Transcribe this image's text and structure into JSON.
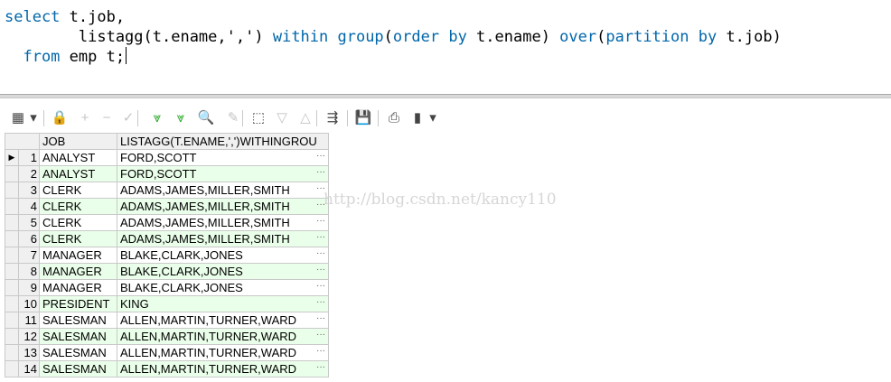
{
  "editor": {
    "lines": [
      [
        {
          "t": "select",
          "c": "kw"
        },
        {
          "t": " t.job,",
          "c": ""
        }
      ],
      [
        {
          "t": "        listagg(t.ename,",
          "c": ""
        },
        {
          "t": "','",
          "c": "str"
        },
        {
          "t": ") ",
          "c": ""
        },
        {
          "t": "within group",
          "c": "kw"
        },
        {
          "t": "(",
          "c": ""
        },
        {
          "t": "order by",
          "c": "kw"
        },
        {
          "t": " t.ename) ",
          "c": ""
        },
        {
          "t": "over",
          "c": "kw"
        },
        {
          "t": "(",
          "c": ""
        },
        {
          "t": "partition by",
          "c": "kw"
        },
        {
          "t": " t.job)",
          "c": ""
        }
      ],
      [
        {
          "t": "  from",
          "c": "kw"
        },
        {
          "t": " emp t;",
          "c": ""
        }
      ]
    ]
  },
  "toolbar": {
    "buttons": [
      {
        "name": "grid-view-icon",
        "glyph": "▦",
        "state": "normal"
      },
      {
        "name": "dropdown-arrow-icon",
        "glyph": "▾",
        "state": "normal"
      },
      {
        "name": "lock-icon",
        "glyph": "🔒",
        "state": "normal"
      },
      {
        "name": "insert-record-icon",
        "glyph": "+",
        "state": "disabled"
      },
      {
        "name": "delete-record-icon",
        "glyph": "−",
        "state": "disabled"
      },
      {
        "name": "post-changes-icon",
        "glyph": "✓",
        "state": "disabled"
      },
      {
        "name": "fetch-next-icon",
        "glyph": "⩔",
        "state": "disabled"
      },
      {
        "name": "fetch-all-icon",
        "glyph": "⩔",
        "state": "disabled"
      },
      {
        "name": "find-icon",
        "glyph": "🔍",
        "state": "normal"
      },
      {
        "name": "clear-icon",
        "glyph": "✎",
        "state": "disabled"
      },
      {
        "name": "query-by-example-icon",
        "glyph": "⬚",
        "state": "normal"
      },
      {
        "name": "previous-record-icon",
        "glyph": "▽",
        "state": "disabled"
      },
      {
        "name": "next-record-icon",
        "glyph": "△",
        "state": "disabled"
      },
      {
        "name": "export-icon",
        "glyph": "⇶",
        "state": "normal"
      },
      {
        "name": "save-icon",
        "glyph": "💾",
        "state": "normal"
      },
      {
        "name": "print-icon",
        "glyph": "⎙",
        "state": "normal"
      },
      {
        "name": "chart-icon",
        "glyph": "▮",
        "state": "normal"
      },
      {
        "name": "chart-dropdown-arrow-icon",
        "glyph": "▾",
        "state": "normal"
      }
    ]
  },
  "grid": {
    "columns": [
      "JOB",
      "LISTAGG(T.ENAME,',')WITHINGROU"
    ],
    "rows": [
      {
        "n": "1",
        "job": "ANALYST",
        "list": "FORD,SCOTT"
      },
      {
        "n": "2",
        "job": "ANALYST",
        "list": "FORD,SCOTT"
      },
      {
        "n": "3",
        "job": "CLERK",
        "list": "ADAMS,JAMES,MILLER,SMITH"
      },
      {
        "n": "4",
        "job": "CLERK",
        "list": "ADAMS,JAMES,MILLER,SMITH"
      },
      {
        "n": "5",
        "job": "CLERK",
        "list": "ADAMS,JAMES,MILLER,SMITH"
      },
      {
        "n": "6",
        "job": "CLERK",
        "list": "ADAMS,JAMES,MILLER,SMITH"
      },
      {
        "n": "7",
        "job": "MANAGER",
        "list": "BLAKE,CLARK,JONES"
      },
      {
        "n": "8",
        "job": "MANAGER",
        "list": "BLAKE,CLARK,JONES"
      },
      {
        "n": "9",
        "job": "MANAGER",
        "list": "BLAKE,CLARK,JONES"
      },
      {
        "n": "10",
        "job": "PRESIDENT",
        "list": "KING"
      },
      {
        "n": "11",
        "job": "SALESMAN",
        "list": "ALLEN,MARTIN,TURNER,WARD"
      },
      {
        "n": "12",
        "job": "SALESMAN",
        "list": "ALLEN,MARTIN,TURNER,WARD"
      },
      {
        "n": "13",
        "job": "SALESMAN",
        "list": "ALLEN,MARTIN,TURNER,WARD"
      },
      {
        "n": "14",
        "job": "SALESMAN",
        "list": "ALLEN,MARTIN,TURNER,WARD"
      }
    ],
    "current_row_marker": "▶",
    "cell_button": "···"
  },
  "watermark": "http://blog.csdn.net/kancy110",
  "colors": {
    "keyword": "#0066aa",
    "alt_row": "#eaffea",
    "header_bg": "#f0f0f0"
  }
}
